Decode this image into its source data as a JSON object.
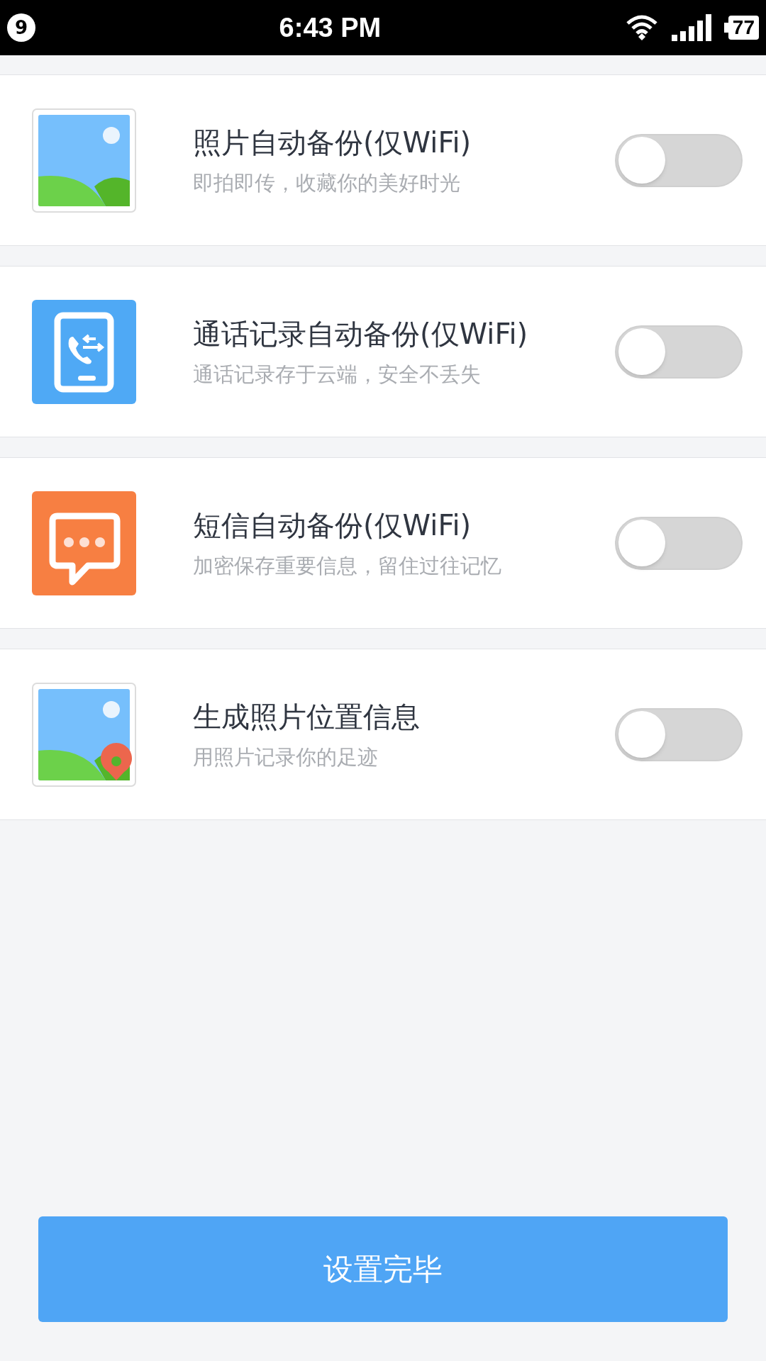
{
  "status_bar": {
    "notification_count": "9",
    "time": "6:43 PM",
    "battery": "77"
  },
  "settings": [
    {
      "kind": "photo",
      "title": "照片自动备份(仅WiFi)",
      "subtitle": "即拍即传，收藏你的美好时光",
      "on": false
    },
    {
      "kind": "calls",
      "title": "通话记录自动备份(仅WiFi)",
      "subtitle": "通话记录存于云端，安全不丢失",
      "on": false
    },
    {
      "kind": "sms",
      "title": "短信自动备份(仅WiFi)",
      "subtitle": "加密保存重要信息，留住过往记忆",
      "on": false
    },
    {
      "kind": "location",
      "title": "生成照片位置信息",
      "subtitle": "用照片记录你的足迹",
      "on": false
    }
  ],
  "done_button": "设置完毕"
}
